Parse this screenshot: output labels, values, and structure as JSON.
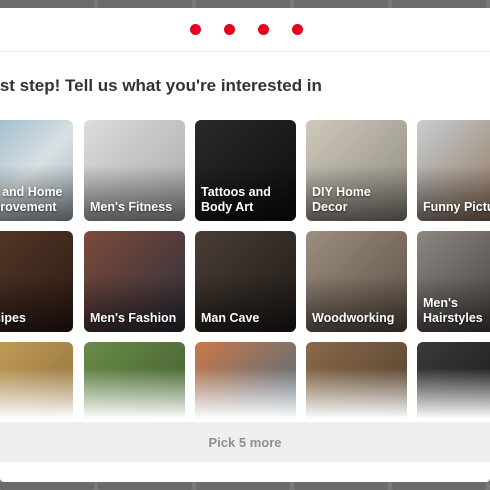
{
  "colors": {
    "accent": "#e60023",
    "heading": "#333333",
    "button_text": "#8e8e8e"
  },
  "progress": {
    "total_steps": 4,
    "current_step": 4
  },
  "heading": "Last step! Tell us what you're interested in",
  "topics": [
    {
      "label": "DIY and Home Improvement"
    },
    {
      "label": "Men's Fitness"
    },
    {
      "label": "Tattoos and Body Art"
    },
    {
      "label": "DIY Home Decor"
    },
    {
      "label": "Funny Pictures"
    },
    {
      "label": "Recipes"
    },
    {
      "label": "Men's Fashion"
    },
    {
      "label": "Man Cave"
    },
    {
      "label": "Woodworking"
    },
    {
      "label": "Men's Hairstyles"
    }
  ],
  "pick_button": {
    "label": "Pick 5 more"
  }
}
